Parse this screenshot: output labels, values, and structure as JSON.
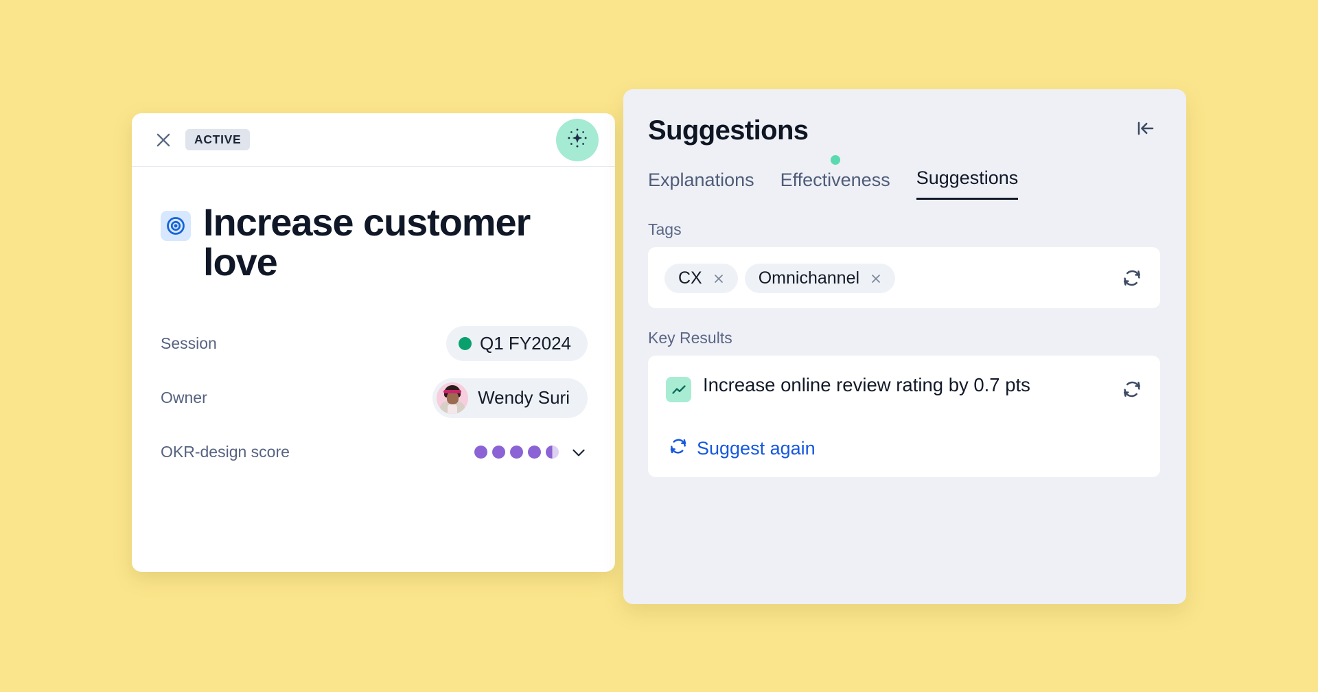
{
  "page": {
    "background_color": "#fbe58c"
  },
  "detail_card": {
    "toolbar": {
      "close_icon": "close-icon",
      "status_badge": "ACTIVE",
      "ai_button_icon": "sparkle-ai-icon",
      "ai_button_color": "#a5ead2"
    },
    "objective": {
      "icon": "target-objective-icon",
      "icon_color": "#1763d6",
      "title": "Increase customer love"
    },
    "fields": [
      {
        "label": "Session",
        "value": "Q1 FY2024",
        "indicator": "status-dot",
        "indicator_color": "#0aa06e",
        "type": "session-pill"
      },
      {
        "label": "Owner",
        "value": "Wendy Suri",
        "indicator": "avatar",
        "type": "owner-pill"
      },
      {
        "label": "OKR-design score",
        "value": "4.5",
        "max": "5",
        "filled_dots": 4,
        "half_dot": true,
        "dot_color": "#8b63d4",
        "dot_empty_color": "#ddd1f2",
        "type": "score-rating",
        "expand_icon": "chevron-down-icon"
      }
    ]
  },
  "suggestions_panel": {
    "title": "Suggestions",
    "collapse_icon": "collapse-panel-left-icon",
    "background_color": "#eef0f6",
    "tabs": [
      {
        "label": "Explanations",
        "active": false,
        "has_dot": false
      },
      {
        "label": "Effectiveness",
        "active": false,
        "has_dot": true,
        "dot_color": "#5ad9b0"
      },
      {
        "label": "Suggestions",
        "active": true,
        "has_dot": false
      }
    ],
    "tags_section": {
      "label": "Tags",
      "refresh_icon": "refresh-icon",
      "chips": [
        {
          "label": "CX",
          "remove_icon": "close-icon"
        },
        {
          "label": "Omnichannel",
          "remove_icon": "close-icon"
        }
      ]
    },
    "key_results_section": {
      "label": "Key Results",
      "items": [
        {
          "icon": "trending-chart-icon",
          "icon_background": "#a8ecd4",
          "text": "Increase online review rating by 0.7 pts",
          "refresh_icon": "refresh-icon"
        }
      ],
      "suggest_again": {
        "label": "Suggest again",
        "icon": "refresh-icon",
        "color": "#1558e0"
      }
    }
  }
}
